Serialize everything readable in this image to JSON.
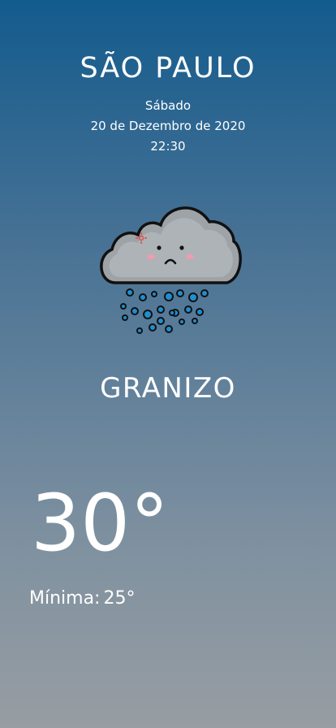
{
  "location": {
    "city": "SÃO PAULO",
    "weekday": "Sábado",
    "date": "20 de Dezembro de 2020",
    "time": "22:30"
  },
  "weather": {
    "icon": "hail-cloud-icon",
    "condition": "GRANIZO",
    "temperature": "30°",
    "min_label": "Mínima:",
    "min_value": "25°"
  },
  "colors": {
    "gradient_top": "#135b8d",
    "gradient_bottom": "#979da2",
    "cloud": "#9ea3a8",
    "hail": "#1e8fd0",
    "text": "#ffffff"
  }
}
